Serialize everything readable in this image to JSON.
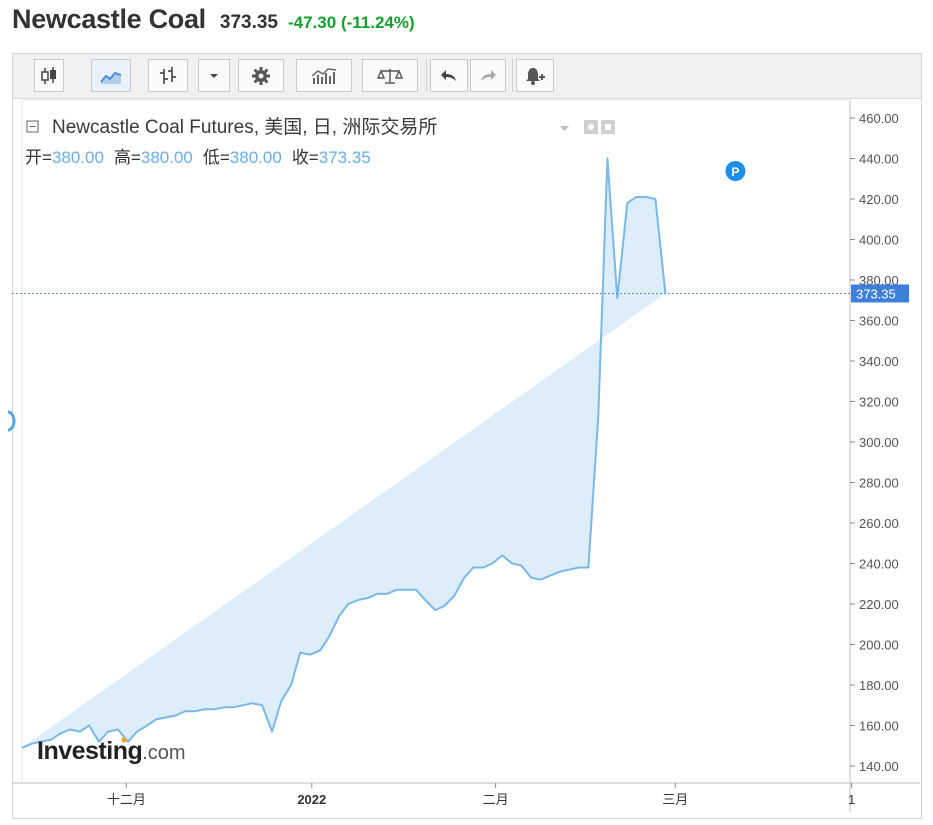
{
  "header": {
    "title": "Newcastle Coal",
    "price": "373.35",
    "change": "-47.30 (-11.24%)"
  },
  "toolbar": {
    "buttons": [
      "candlestick-icon",
      "line-chart-icon",
      "bar-chart-icon",
      "dropdown-arrow-icon",
      "gear-icon",
      "indicators-icon",
      "compare-scale-icon",
      "undo-icon",
      "redo-icon",
      "alert-bell-icon"
    ]
  },
  "legend": {
    "name": "Newcastle Coal Futures, 美国, 日, 洲际交易所",
    "open_label": "开=",
    "open": "380.00",
    "high_label": "高=",
    "high": "380.00",
    "low_label": "低=",
    "low": "380.00",
    "close_label": "收=",
    "close": "373.35"
  },
  "watermark": {
    "brand": "Investing",
    "suffix": ".com"
  },
  "marker_label": "P",
  "colors": {
    "line": "#7ab8e8",
    "fill": "#ddeefa",
    "up": "#14a02d",
    "accent": "#4f8fd6",
    "axis_text": "#555555"
  },
  "chart_data": {
    "type": "area",
    "title": "Newcastle Coal Futures, 美国, 日, 洲际交易所",
    "xlabel": "",
    "ylabel": "",
    "ylim": [
      130,
      470
    ],
    "y_ticks": [
      "140.00",
      "160.00",
      "180.00",
      "200.00",
      "220.00",
      "240.00",
      "260.00",
      "280.00",
      "300.00",
      "320.00",
      "340.00",
      "360.00",
      "380.00",
      "400.00",
      "420.00",
      "440.00",
      "460.00"
    ],
    "x_tick_labels": [
      "十二月",
      "2022",
      "二月",
      "三月",
      "1"
    ],
    "x_tick_positions": [
      12.6,
      35.0,
      57.2,
      78.9,
      100.2
    ],
    "current_price": 373.35,
    "current_price_label": "373.35",
    "x_range": [
      0,
      100
    ],
    "x": [
      0,
      1.2,
      2.3,
      3.5,
      4.6,
      5.8,
      7.0,
      8.1,
      9.3,
      10.4,
      11.6,
      12.8,
      13.9,
      15.1,
      16.2,
      17.4,
      18.6,
      19.7,
      20.9,
      22.0,
      23.2,
      24.4,
      25.5,
      26.7,
      27.8,
      29.0,
      30.2,
      31.3,
      32.5,
      33.6,
      34.8,
      36.0,
      37.1,
      38.3,
      39.4,
      40.6,
      41.8,
      42.9,
      44.1,
      45.2,
      46.4,
      47.6,
      48.7,
      49.9,
      51.0,
      52.2,
      53.4,
      54.5,
      55.7,
      56.8,
      58.0,
      59.2,
      60.3,
      61.5,
      62.6,
      63.8,
      65.0,
      66.1,
      67.3,
      68.4,
      69.6,
      70.7,
      71.9,
      73.1,
      74.2,
      75.4,
      76.5,
      77.7,
      78.9,
      80.0,
      81.2,
      82.3,
      83.5,
      84.7,
      85.8,
      87.0,
      88.1,
      89.3
    ],
    "y": [
      149,
      151,
      152,
      153,
      156,
      158,
      157,
      160,
      152,
      157,
      158,
      152,
      157,
      160,
      163,
      164,
      165,
      167,
      167,
      168,
      168,
      169,
      169,
      170,
      171,
      170,
      157,
      172,
      180,
      196,
      195,
      197,
      204,
      214,
      220,
      222,
      223,
      225,
      225,
      227,
      227,
      227,
      222,
      217,
      219,
      224,
      233,
      238,
      238,
      240,
      244,
      240,
      239,
      233,
      232,
      234,
      236,
      237,
      238,
      238,
      313,
      440,
      371,
      418,
      421,
      421,
      420,
      373.35
    ]
  }
}
